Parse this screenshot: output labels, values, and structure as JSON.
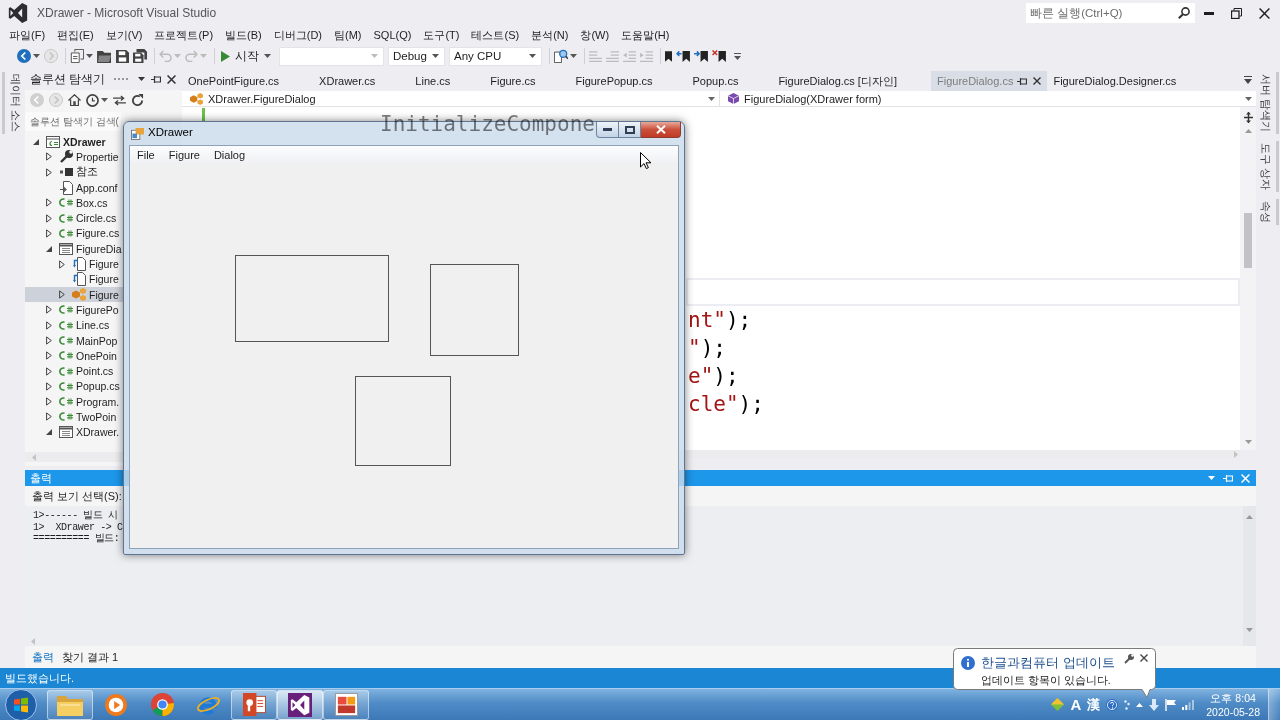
{
  "window": {
    "title": "XDrawer - Microsoft Visual Studio",
    "quick_launch": {
      "placeholder": "빠른 실행(Ctrl+Q)"
    }
  },
  "menu": [
    "파일(F)",
    "편집(E)",
    "보기(V)",
    "프로젝트(P)",
    "빌드(B)",
    "디버그(D)",
    "팀(M)",
    "SQL(Q)",
    "도구(T)",
    "테스트(S)",
    "분석(N)",
    "창(W)",
    "도움말(H)"
  ],
  "toolbar": {
    "groups": [
      [
        {
          "kind": "back",
          "disabled": false,
          "dropdown": true
        },
        {
          "kind": "forward",
          "disabled": true,
          "dropdown": false
        }
      ],
      [
        {
          "kind": "new-project",
          "disabled": false,
          "dropdown": true
        },
        {
          "kind": "open",
          "disabled": false,
          "dropdown": false
        },
        {
          "kind": "save",
          "disabled": false,
          "dropdown": false
        },
        {
          "kind": "save-all",
          "disabled": false,
          "dropdown": false
        }
      ],
      [
        {
          "kind": "undo",
          "disabled": true,
          "dropdown": true
        },
        {
          "kind": "redo",
          "disabled": true,
          "dropdown": true
        }
      ]
    ],
    "start": {
      "label": "시작"
    },
    "configuration": {
      "value": "Debug"
    },
    "platform": {
      "value": "Any CPU"
    },
    "tool_groups": [
      [
        {
          "kind": "find",
          "disabled": false,
          "dropdown": true
        }
      ],
      [
        {
          "kind": "comment",
          "disabled": true,
          "dropdown": false
        },
        {
          "kind": "uncomment",
          "disabled": true,
          "dropdown": false
        },
        {
          "kind": "outdent",
          "disabled": true,
          "dropdown": false
        },
        {
          "kind": "indent",
          "disabled": true,
          "dropdown": false
        }
      ],
      [
        {
          "kind": "bookmark",
          "disabled": false,
          "dropdown": false
        },
        {
          "kind": "bookmark-prev",
          "disabled": false,
          "dropdown": false
        },
        {
          "kind": "bookmark-next",
          "disabled": false,
          "dropdown": false
        },
        {
          "kind": "bookmark-clear",
          "disabled": false,
          "dropdown": false
        }
      ]
    ]
  },
  "side_tabs": {
    "left": [
      {
        "label": "데이터 소스"
      }
    ],
    "right": [
      {
        "label": "서버 탐색기"
      },
      {
        "label": "도구 상자"
      },
      {
        "label": "속성"
      }
    ]
  },
  "solution_explorer": {
    "title": "솔루션 탐색기",
    "toolbar": [
      {
        "kind": "back",
        "disabled": true,
        "dropdown": false
      },
      {
        "kind": "forward",
        "disabled": true,
        "dropdown": false
      },
      {
        "kind": "home",
        "disabled": false,
        "dropdown": false
      },
      {
        "kind": "history",
        "disabled": false,
        "dropdown": true
      },
      {
        "kind": "sync",
        "disabled": false,
        "dropdown": false
      },
      {
        "kind": "refresh",
        "disabled": false,
        "dropdown": false
      }
    ],
    "search": {
      "placeholder": "솔루션 탐색기 검색("
    },
    "tree": [
      {
        "label": "XDrawer",
        "kind": "project",
        "expanded": true,
        "selected": false,
        "children": [
          {
            "label": "Propertie",
            "kind": "properties",
            "expanded": false,
            "selected": false
          },
          {
            "label": "참조",
            "kind": "references",
            "expanded": false,
            "selected": false
          },
          {
            "label": "App.conf",
            "kind": "config",
            "selected": false
          },
          {
            "label": "Box.cs",
            "kind": "csharp",
            "expanded": false,
            "selected": false
          },
          {
            "label": "Circle.cs",
            "kind": "csharp",
            "expanded": false,
            "selected": false
          },
          {
            "label": "Figure.cs",
            "kind": "csharp",
            "expanded": false,
            "selected": false
          },
          {
            "label": "FigureDia",
            "kind": "form",
            "expanded": true,
            "selected": false,
            "children": [
              {
                "label": "Figure",
                "kind": "form-file",
                "expanded": false,
                "selected": false
              },
              {
                "label": "Figure",
                "kind": "form-file",
                "selected": false
              },
              {
                "label": "Figure",
                "kind": "form-code",
                "expanded": false,
                "selected": true
              }
            ]
          },
          {
            "label": "FigurePo",
            "kind": "csharp",
            "expanded": false,
            "selected": false
          },
          {
            "label": "Line.cs",
            "kind": "csharp",
            "expanded": false,
            "selected": false
          },
          {
            "label": "MainPop",
            "kind": "csharp",
            "expanded": false,
            "selected": false
          },
          {
            "label": "OnePoin",
            "kind": "csharp",
            "expanded": false,
            "selected": false
          },
          {
            "label": "Point.cs",
            "kind": "csharp",
            "expanded": false,
            "selected": false
          },
          {
            "label": "Popup.cs",
            "kind": "csharp",
            "expanded": false,
            "selected": false
          },
          {
            "label": "Program.",
            "kind": "csharp",
            "expanded": false,
            "selected": false
          },
          {
            "label": "TwoPoin",
            "kind": "csharp",
            "expanded": false,
            "selected": false
          },
          {
            "label": "XDrawer.",
            "kind": "form",
            "expanded": true,
            "selected": false
          }
        ]
      }
    ]
  },
  "editor": {
    "tabs": [
      {
        "label": "OnePointFigure.cs",
        "selected": false
      },
      {
        "label": "XDrawer.cs",
        "selected": false
      },
      {
        "label": "Line.cs",
        "selected": false
      },
      {
        "label": "Figure.cs",
        "selected": false
      },
      {
        "label": "FigurePopup.cs",
        "selected": false
      },
      {
        "label": "Popup.cs",
        "selected": false
      },
      {
        "label": "FigureDialog.cs [디자인]",
        "selected": false
      },
      {
        "label": "FigureDialog.cs",
        "selected": true
      },
      {
        "label": "FigureDialog.Designer.cs",
        "selected": false
      }
    ],
    "navigation": {
      "type": "XDrawer.FigureDialog",
      "member": "FigureDialog(XDrawer form)"
    },
    "lines": [
      {
        "segments": [
          {
            "text": "InitializeCompone",
            "kind": "plain"
          }
        ],
        "current": false
      },
      {
        "current": false
      },
      {
        "current": false
      },
      {
        "current": false
      },
      {
        "current": false
      },
      {
        "current": false
      },
      {
        "current": true
      },
      {
        "segments": [
          {
            "text": "nt\"",
            "kind": "string"
          },
          {
            "text": ");",
            "kind": "plain"
          }
        ],
        "current": false
      },
      {
        "segments": [
          {
            "text": "\"",
            "kind": "string"
          },
          {
            "text": ");",
            "kind": "plain"
          }
        ],
        "current": false
      },
      {
        "segments": [
          {
            "text": "e\"",
            "kind": "string"
          },
          {
            "text": ");",
            "kind": "plain"
          }
        ],
        "current": false
      },
      {
        "segments": [
          {
            "text": "cle\"",
            "kind": "string"
          },
          {
            "text": ");",
            "kind": "plain"
          }
        ],
        "current": false
      }
    ]
  },
  "dialog": {
    "title": "XDrawer",
    "menu": [
      "File",
      "Figure",
      "Dialog"
    ],
    "figures": [
      {
        "kind": "rectangle"
      },
      {
        "kind": "rectangle"
      },
      {
        "kind": "rectangle"
      }
    ]
  },
  "output": {
    "title": "출력",
    "source_label": "출력 보기 선택(S):",
    "lines": [
      "1>------ 빌드 시",
      "1>  XDrawer -> C",
      "========== 빌드:"
    ],
    "tabs": [
      {
        "label": "출력",
        "selected": true
      },
      {
        "label": "찾기 결과 1",
        "selected": false
      }
    ]
  },
  "status_bar": {
    "text": "빌드했습니다."
  },
  "taskbar": {
    "apps": [
      {
        "kind": "folder",
        "running": true,
        "selected": false
      },
      {
        "kind": "play",
        "running": false,
        "selected": false
      },
      {
        "kind": "wheel",
        "running": false,
        "selected": false
      },
      {
        "kind": "e-globe",
        "running": false,
        "selected": false
      },
      {
        "kind": "slides",
        "running": true,
        "selected": false
      },
      {
        "kind": "infinity",
        "running": true,
        "selected": true
      },
      {
        "kind": "tiles",
        "running": true,
        "selected": false
      }
    ],
    "tray": {
      "ime": [
        "A",
        "漢"
      ],
      "time": "오후 8:04",
      "date": "2020-05-28"
    }
  },
  "notification": {
    "title": "한글과컴퓨터 업데이트",
    "message": "업데이트 항목이 있습니다."
  }
}
